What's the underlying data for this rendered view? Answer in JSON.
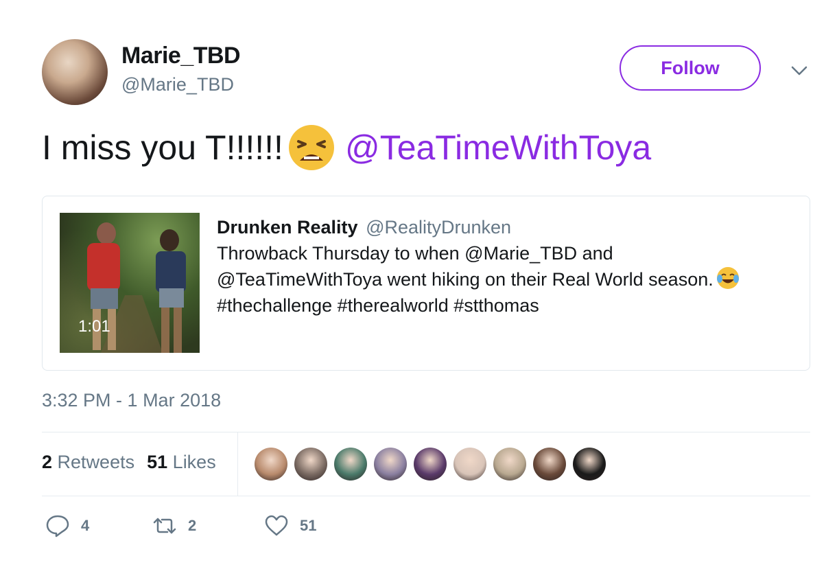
{
  "author": {
    "display_name": "Marie_TBD",
    "handle": "@Marie_TBD"
  },
  "follow_button": {
    "label": "Follow",
    "color": "#8a2be2"
  },
  "tweet": {
    "text": "I miss you T!!!!!!",
    "emoji": "weary-face",
    "mention": "@TeaTimeWithToya"
  },
  "quoted_tweet": {
    "author_name": "Drunken Reality",
    "author_handle": "@RealityDrunken",
    "body_line1": "Throwback Thursday to when @Marie_TBD and",
    "body_line2": "@TeaTimeWithToya went hiking on their Real World season.",
    "emoji": "face-with-tears-of-joy",
    "body_line3": "#thechallenge #therealworld #stthomas",
    "video_duration": "1:01"
  },
  "timestamp": "3:32 PM - 1 Mar 2018",
  "stats": {
    "retweets_count": "2",
    "retweets_label": "Retweets",
    "likes_count": "51",
    "likes_label": "Likes"
  },
  "likers": [
    {
      "name": "liker-1",
      "color": "#b88a6c"
    },
    {
      "name": "liker-2",
      "color": "#7a6a62"
    },
    {
      "name": "liker-3",
      "color": "#4a7a6a"
    },
    {
      "name": "liker-4",
      "color": "#8a7fa0"
    },
    {
      "name": "liker-5",
      "color": "#5a3a6a"
    },
    {
      "name": "liker-6",
      "color": "#d8c4b8"
    },
    {
      "name": "liker-7",
      "color": "#b8a890"
    },
    {
      "name": "liker-8",
      "color": "#6a4a3a"
    },
    {
      "name": "liker-9",
      "color": "#1a1a1a"
    }
  ],
  "actions": {
    "reply_count": "4",
    "retweet_count": "2",
    "like_count": "51"
  }
}
